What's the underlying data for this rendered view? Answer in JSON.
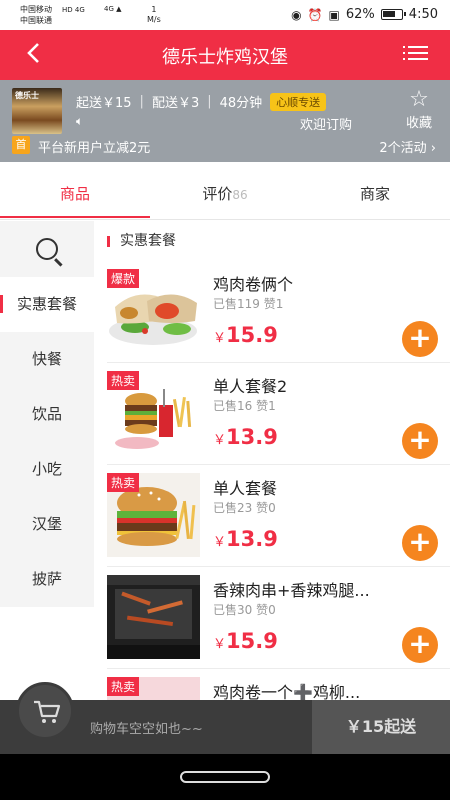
{
  "status_bar": {
    "carrier1": "中国移动",
    "carrier2": "中国联通",
    "hd": "HD",
    "net": "4G",
    "speed": "1",
    "speed_unit": "M/s",
    "battery": "62%",
    "time": "4:50"
  },
  "header": {
    "title": "德乐士炸鸡汉堡"
  },
  "store": {
    "logo_text": "德乐士",
    "min_order": "起送￥15",
    "delivery_fee": "配送￥3",
    "delivery_time": "48分钟",
    "badge": "心顺专送",
    "welcome": "欢迎订购",
    "favorite_label": "收藏",
    "promo_badge": "首",
    "promo_text": "平台新用户立减2元",
    "activities": "2个活动"
  },
  "tabs": [
    {
      "label": "商品",
      "count": ""
    },
    {
      "label": "评价",
      "count": "86"
    },
    {
      "label": "商家",
      "count": ""
    }
  ],
  "sidebar": {
    "categories": [
      "实惠套餐",
      "快餐",
      "饮品",
      "小吃",
      "汉堡",
      "披萨"
    ]
  },
  "section": {
    "title": "实惠套餐"
  },
  "products": [
    {
      "tag": "爆款",
      "name": "鸡肉卷俩个",
      "sold": "已售119",
      "likes": "赞1",
      "currency": "￥",
      "price": "15.9"
    },
    {
      "tag": "热卖",
      "name": "单人套餐2",
      "sold": "已售16",
      "likes": "赞1",
      "currency": "￥",
      "price": "13.9"
    },
    {
      "tag": "热卖",
      "name": "单人套餐",
      "sold": "已售23",
      "likes": "赞0",
      "currency": "￥",
      "price": "13.9"
    },
    {
      "tag": "",
      "name": "香辣肉串+香辣鸡腿...",
      "sold": "已售30",
      "likes": "赞0",
      "currency": "￥",
      "price": "15.9"
    },
    {
      "tag": "热卖",
      "name": "鸡肉卷一个➕鸡柳...",
      "sold": "",
      "likes": "",
      "currency": "",
      "price": ""
    }
  ],
  "cart": {
    "empty_text": "购物车空空如也~~",
    "min_order_button": "￥15起送"
  },
  "colors": {
    "brand": "#f02e45",
    "add_button": "#f5851f",
    "badge_yellow": "#f7c318"
  }
}
